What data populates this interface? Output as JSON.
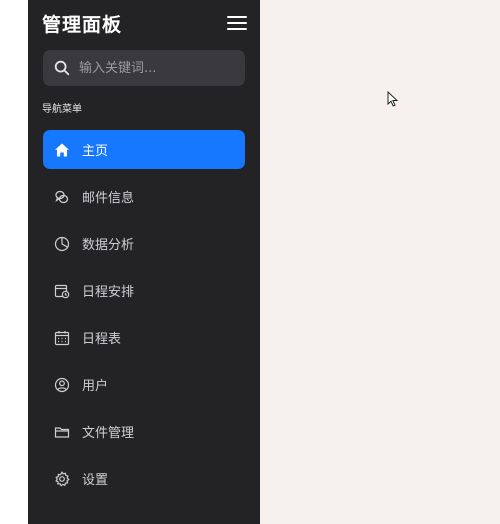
{
  "sidebar": {
    "title": "管理面板",
    "search": {
      "placeholder": "输入关键词...",
      "value": ""
    },
    "section_label": "导航菜单",
    "items": [
      {
        "label": "主页",
        "icon": "home-icon",
        "active": true
      },
      {
        "label": "邮件信息",
        "icon": "chat-bubbles-icon",
        "active": false
      },
      {
        "label": "数据分析",
        "icon": "pie-chart-icon",
        "active": false
      },
      {
        "label": "日程安排",
        "icon": "schedule-icon",
        "active": false
      },
      {
        "label": "日程表",
        "icon": "calendar-icon",
        "active": false
      },
      {
        "label": "用户",
        "icon": "user-icon",
        "active": false
      },
      {
        "label": "文件管理",
        "icon": "folder-icon",
        "active": false
      },
      {
        "label": "设置",
        "icon": "gear-icon",
        "active": false
      }
    ]
  },
  "colors": {
    "sidebar_bg": "#232326",
    "active_bg": "#1677ff",
    "content_bg": "#f6f1ee"
  }
}
